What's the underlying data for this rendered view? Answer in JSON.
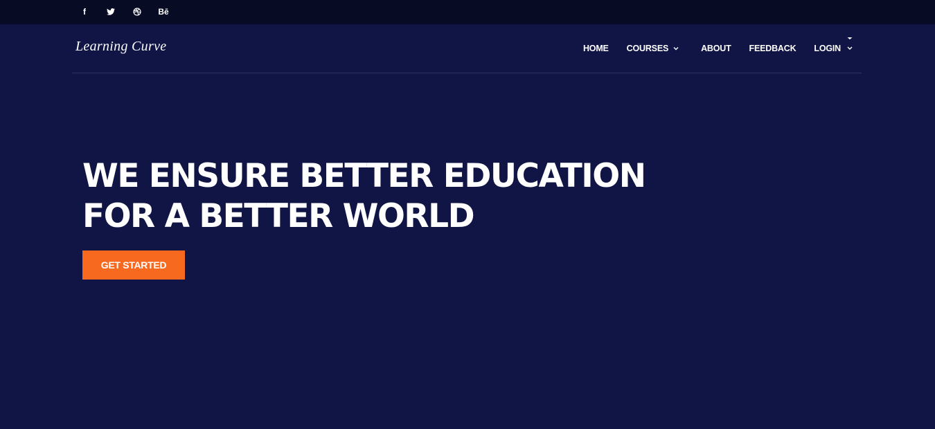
{
  "topbar": {
    "social": [
      {
        "name": "facebook-icon",
        "glyph": "f"
      },
      {
        "name": "twitter-icon",
        "glyph": ""
      },
      {
        "name": "dribbble-icon",
        "glyph": ""
      },
      {
        "name": "behance-icon",
        "glyph": "Bē"
      }
    ]
  },
  "header": {
    "logo": "Learning Curve",
    "nav": {
      "home": "HOME",
      "courses": "COURSES",
      "about": "ABOUT",
      "feedback": "FEEDBACK",
      "login": "LOGIN"
    }
  },
  "hero": {
    "title_line1": "WE ENSURE BETTER EDUCATION",
    "title_line2": "FOR A BETTER WORLD",
    "cta_label": "GET STARTED"
  },
  "colors": {
    "page_bg": "#111545",
    "topbar_bg": "#070b24",
    "accent": "#f7691f",
    "text": "#ffffff"
  }
}
